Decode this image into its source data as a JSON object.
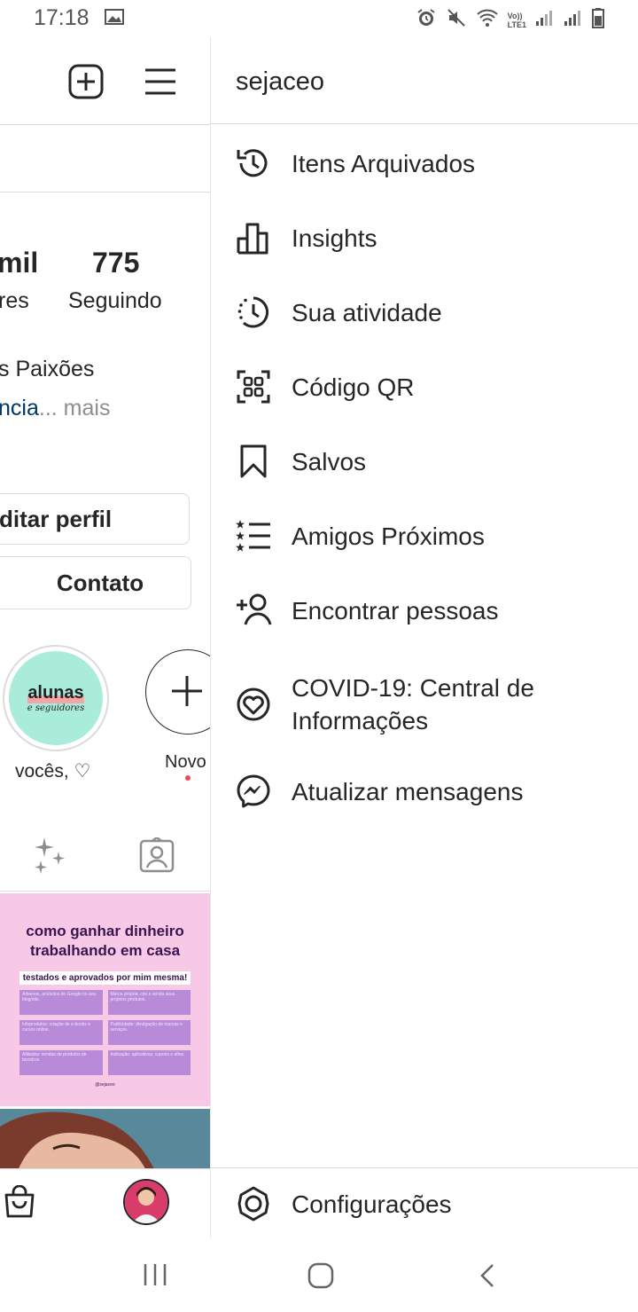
{
  "status_bar": {
    "time": "17:18",
    "icons": [
      "image-icon",
      "alarm-icon",
      "mute-icon",
      "wifi-icon",
      "volte-icon",
      "signal-icon",
      "signal-icon",
      "battery-icon"
    ],
    "volte_label_top": "Vo))",
    "volte_label_bottom": "LTE1"
  },
  "profile": {
    "stats": [
      {
        "number": "mil",
        "label": "res"
      },
      {
        "number": "775",
        "label": "Seguindo"
      }
    ],
    "bio_line1": "s Paixões",
    "bio_link": "ncia",
    "bio_more": "... mais",
    "edit_profile_label": "ditar perfil",
    "contact_label": "Contato",
    "highlights": [
      {
        "title": "alunas",
        "subtitle": "e seguidores",
        "label": "vocês, ♡"
      },
      {
        "label": "Novo"
      }
    ],
    "post": {
      "title_line1": "como ganhar dinheiro",
      "title_line2": "trabalhando em casa",
      "subtitle": "testados e aprovados por mim mesma!",
      "boxes": [
        "Adsense, anúncios do Google no seu blog/site.",
        "Marca própria: crie e venda seus próprios produtos.",
        "Infoprodutos: criação de e-books e cursos online.",
        "Publicidade: divulgação de marcas e serviços.",
        "Afiliados: vendas de produtos de terceiros.",
        "Indicação: aplicativos, cupons e afins."
      ],
      "footer": "@sejaceo"
    }
  },
  "drawer": {
    "username": "sejaceo",
    "items": [
      {
        "label": "Itens Arquivados",
        "icon": "archive-history-icon"
      },
      {
        "label": "Insights",
        "icon": "insights-chart-icon"
      },
      {
        "label": "Sua atividade",
        "icon": "activity-clock-icon"
      },
      {
        "label": "Código QR",
        "icon": "qr-code-icon"
      },
      {
        "label": "Salvos",
        "icon": "bookmark-icon"
      },
      {
        "label": "Amigos Próximos",
        "icon": "close-friends-list-icon"
      },
      {
        "label": "Encontrar pessoas",
        "icon": "add-person-icon"
      },
      {
        "label": "COVID-19: Central de Informações",
        "icon": "covid-heart-icon"
      },
      {
        "label": "Atualizar mensagens",
        "icon": "messenger-icon"
      }
    ],
    "settings_label": "Configurações"
  }
}
